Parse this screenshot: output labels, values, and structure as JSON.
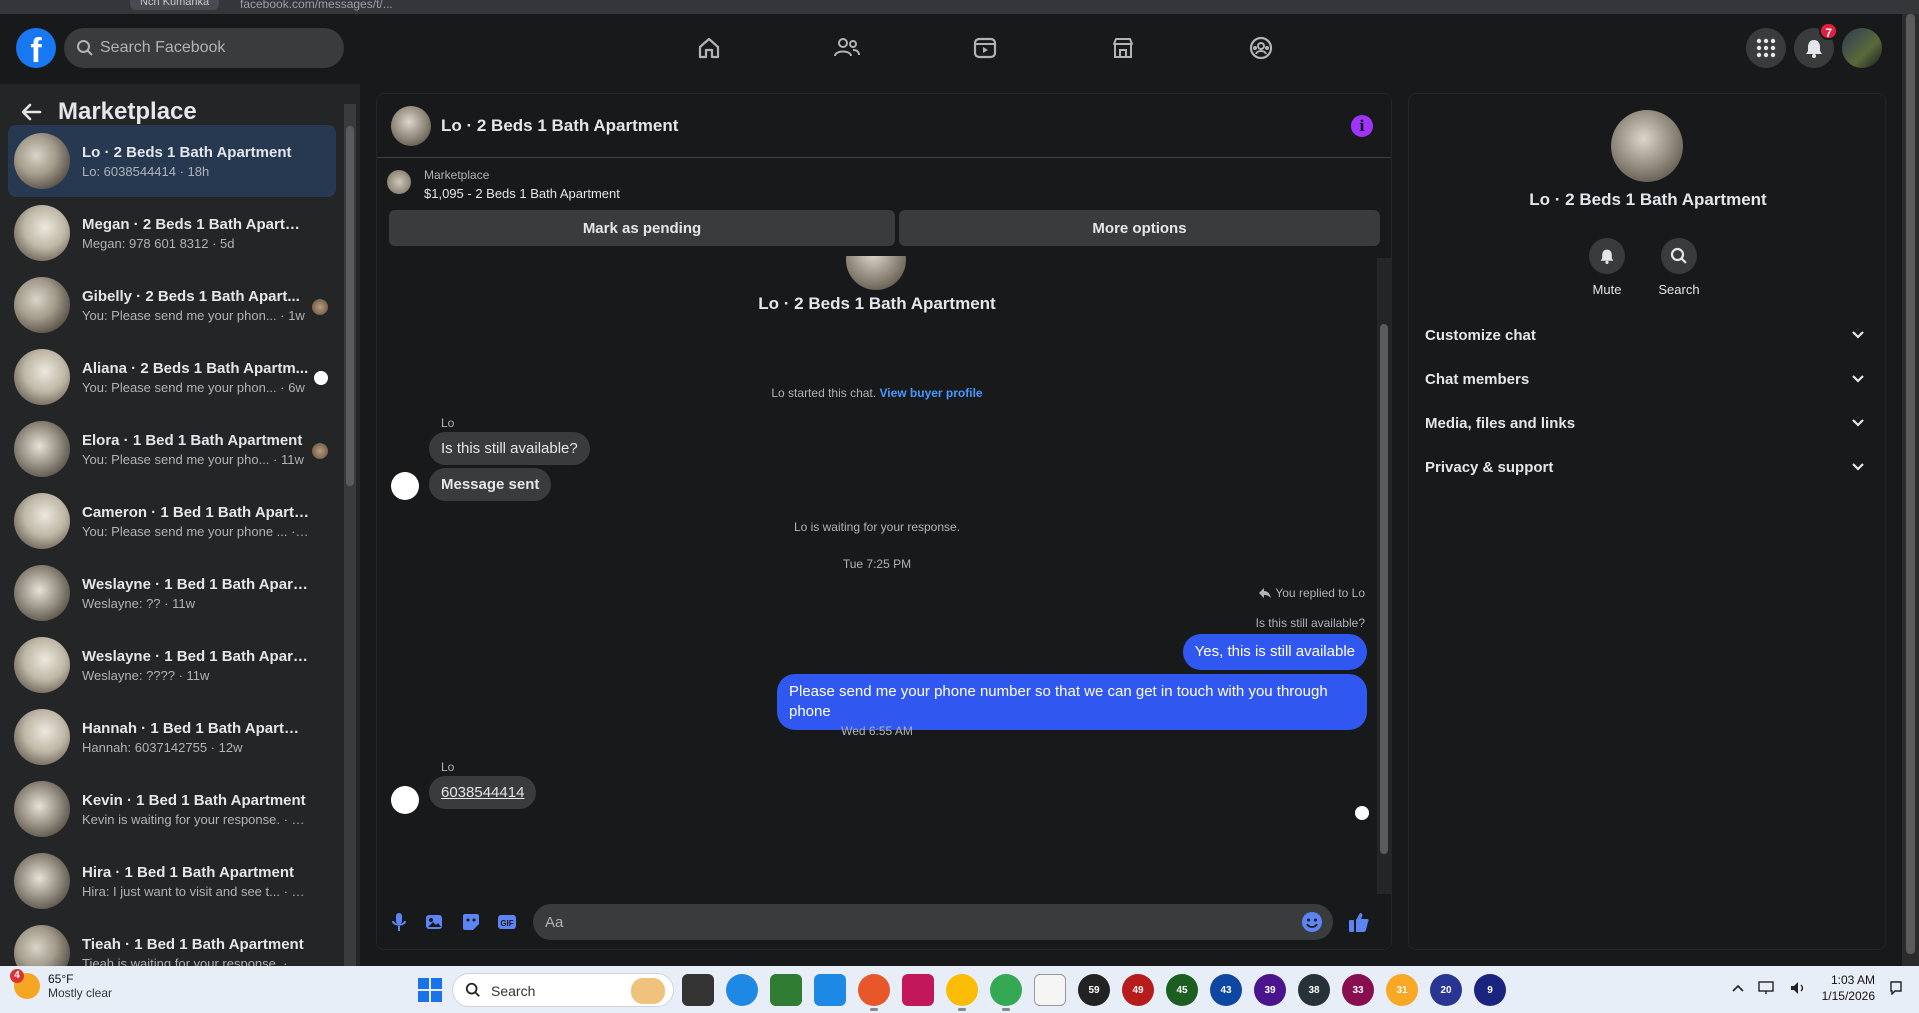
{
  "browser": {
    "url": "facebook.com/messages/t/...",
    "tab_chip": "Nch Kumanka"
  },
  "topnav": {
    "search_placeholder": "Search Facebook",
    "nav_icons": [
      "home-icon",
      "friends-icon",
      "video-icon",
      "marketplace-icon",
      "groups-icon"
    ],
    "notifications_count": "7"
  },
  "sidebar": {
    "title": "Marketplace",
    "conversations": [
      {
        "name": "Lo · 2 Beds 1 Bath Apartment",
        "preview": "Lo: 6038544414 · 18h",
        "active": true
      },
      {
        "name": "Megan · 2 Beds 1 Bath Apartment",
        "preview": "Megan: 978 601 8312 · 5d"
      },
      {
        "name": "Gibelly · 2 Beds 1 Bath Apart...",
        "preview": "You: Please send me your phon... · 1w"
      },
      {
        "name": "Aliana · 2 Beds 1 Bath Apartm...",
        "preview": "You: Please send me your phon... · 6w"
      },
      {
        "name": "Elora · 1 Bed 1 Bath Apartment",
        "preview": "You: Please send me your pho... · 11w"
      },
      {
        "name": "Cameron · 1 Bed 1 Bath Apartme...",
        "preview": "You: Please send me your phone ... · 11w"
      },
      {
        "name": "Weslayne · 1 Bed 1 Bath Apartm...",
        "preview": "Weslayne: ?? · 11w"
      },
      {
        "name": "Weslayne · 1 Bed 1 Bath Apartm...",
        "preview": "Weslayne: ???? · 11w"
      },
      {
        "name": "Hannah · 1 Bed 1 Bath Apartment",
        "preview": "Hannah: 6037142755 · 12w"
      },
      {
        "name": "Kevin · 1 Bed 1 Bath Apartment",
        "preview": "Kevin is waiting for your response. · 12w"
      },
      {
        "name": "Hira · 1 Bed 1 Bath Apartment",
        "preview": "Hira: I just want to visit and see t... · 12w"
      },
      {
        "name": "Tieah · 1 Bed 1 Bath Apartment",
        "preview": "Tieah is waiting for your response. · 12w"
      }
    ]
  },
  "chat": {
    "title": "Lo · 2 Beds 1 Bath Apartment",
    "listing_source": "Marketplace",
    "listing_title": "$1,095 - 2 Beds 1 Bath Apartment",
    "mark_pending_label": "Mark as pending",
    "more_options_label": "More options",
    "center_name": "Lo · 2 Beds 1 Bath Apartment",
    "started_text": "Lo started this chat.",
    "view_profile_link": "View buyer profile",
    "sender1": "Lo",
    "msg1": "Is this still available?",
    "msg2": "Message sent",
    "waiting_text": "Lo is waiting for your response.",
    "time1": "Tue 7:25 PM",
    "replied_note": "You replied to Lo",
    "replied_quote": "Is this still available?",
    "out1": "Yes, this is still available",
    "out2": "Please send me your phone  number so that we can get in touch with you through phone",
    "time2": "Wed 6:55 AM",
    "sender2": "Lo",
    "msg3": "6038544414",
    "composer_placeholder": "Aa"
  },
  "infopanel": {
    "name": "Lo · 2 Beds 1 Bath Apartment",
    "mute_label": "Mute",
    "search_label": "Search",
    "sections": [
      "Customize chat",
      "Chat members",
      "Media, files and links",
      "Privacy & support"
    ]
  },
  "taskbar": {
    "weather_badge": "4",
    "temperature": "65°F",
    "condition": "Mostly clear",
    "search_label": "Search",
    "app_badges": [
      "59",
      "49",
      "45",
      "43",
      "39",
      "38",
      "33",
      "31",
      "20",
      "9"
    ],
    "time": "1:03 AM",
    "date": "1/15/2026"
  },
  "colors": {
    "accent": "#3058f0",
    "facebook_blue": "#1877f2",
    "info_purple": "#a033ff",
    "active_row": "#263951"
  }
}
